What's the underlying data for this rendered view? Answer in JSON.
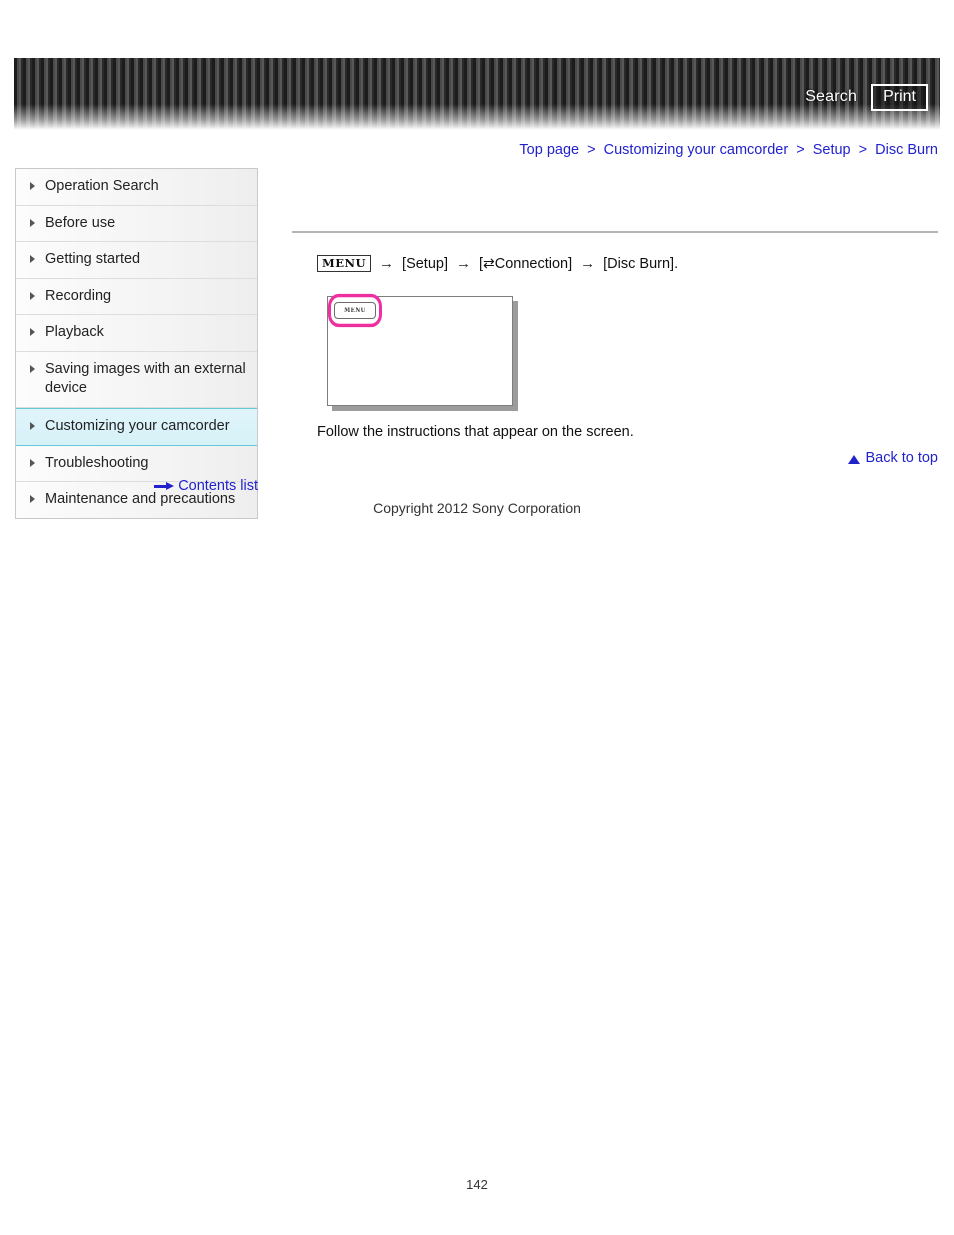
{
  "header": {
    "search_label": "Search",
    "print_label": "Print"
  },
  "breadcrumb": {
    "separator": ">",
    "items": [
      {
        "label": "Top page"
      },
      {
        "label": "Customizing your camcorder"
      },
      {
        "label": "Setup"
      },
      {
        "label": "Disc Burn"
      }
    ]
  },
  "sidebar": {
    "items": [
      {
        "label": "Operation Search",
        "active": false
      },
      {
        "label": "Before use",
        "active": false
      },
      {
        "label": "Getting started",
        "active": false
      },
      {
        "label": "Recording",
        "active": false
      },
      {
        "label": "Playback",
        "active": false
      },
      {
        "label": "Saving images with an external device",
        "active": false
      },
      {
        "label": "Customizing your camcorder",
        "active": true
      },
      {
        "label": "Troubleshooting",
        "active": false
      },
      {
        "label": "Maintenance and precautions",
        "active": false
      }
    ],
    "contents_list_label": "Contents list"
  },
  "main": {
    "menu_path": {
      "menu_chip": "MENU",
      "arrow": "→",
      "step_setup": "[Setup]",
      "step_connection_open": "[",
      "step_connection_icon": "⇄",
      "step_connection_label": "Connection]",
      "step_disc_burn": "[Disc Burn]."
    },
    "illustration": {
      "menu_button_label": "MENU",
      "highlight_color": "#ef2fa0"
    },
    "instruction": "Follow the instructions that appear on the screen.",
    "back_to_top_label": "Back to top"
  },
  "footer": {
    "copyright": "Copyright 2012 Sony Corporation",
    "page_number": "142"
  }
}
